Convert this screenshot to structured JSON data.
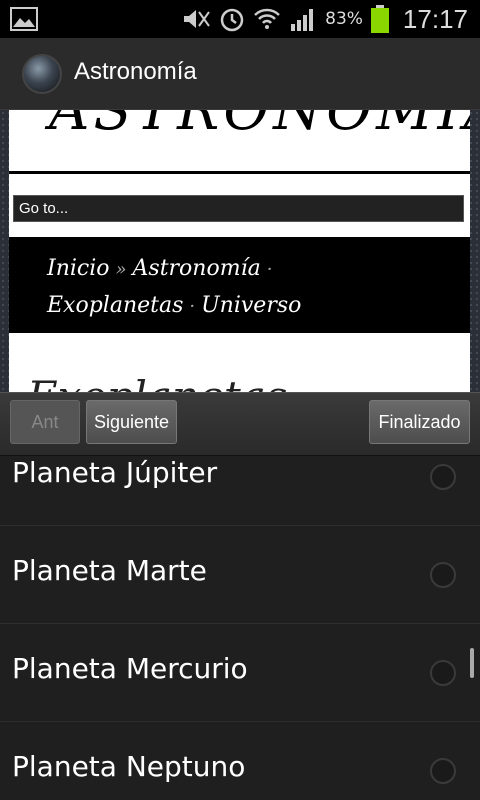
{
  "status_bar": {
    "icons": [
      "gallery-icon",
      "mute-icon",
      "alarm-icon",
      "wifi-icon",
      "signal-icon",
      "battery-icon"
    ],
    "battery_percent": "83%",
    "time": "17:17"
  },
  "action_bar": {
    "title": "Astronomía"
  },
  "web_page": {
    "site_title": "ASTRONOMIA",
    "goto_label": "Go to...",
    "nav_links": [
      "Inicio",
      "Astronomía",
      "Exoplanetas",
      "Universo"
    ],
    "nav_sep_arrow": "»",
    "nav_sep_dot": "·",
    "section_heading": "Exoplanetas"
  },
  "picker_toolbar": {
    "prev_label": "Ant",
    "next_label": "Siguiente",
    "done_label": "Finalizado"
  },
  "options": [
    {
      "label": "Planeta Júpiter",
      "selected": false
    },
    {
      "label": "Planeta Marte",
      "selected": false
    },
    {
      "label": "Planeta Mercurio",
      "selected": false
    },
    {
      "label": "Planeta Neptuno",
      "selected": false
    }
  ]
}
